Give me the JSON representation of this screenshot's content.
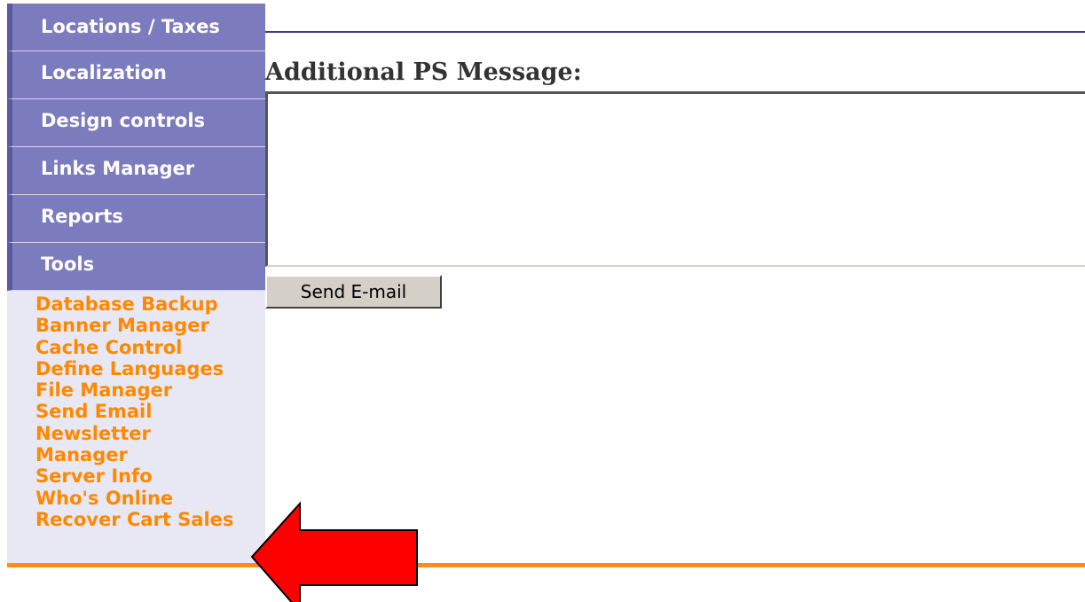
{
  "sidebar": {
    "headers": [
      "Locations / Taxes",
      "Localization",
      "Design controls",
      "Links Manager",
      "Reports",
      "Tools"
    ],
    "tool_links": [
      "Database Backup",
      "Banner Manager",
      "Cache Control",
      "Define Languages",
      "File Manager",
      "Send Email",
      "Newsletter",
      "Manager",
      "Server Info",
      "Who's Online",
      "Recover Cart Sales"
    ]
  },
  "main": {
    "ps_label": "Additional PS Message:",
    "ps_value": "",
    "send_button": "Send E-mail"
  },
  "colors": {
    "menu_header_bg": "#7b7bbd",
    "sidebar_bg": "#e8e8f4",
    "link_color": "#ff8800",
    "bottom_rule": "#ff8c1a",
    "arrow": "#ff0000"
  },
  "annotation": {
    "icon": "red-arrow-left-icon"
  }
}
